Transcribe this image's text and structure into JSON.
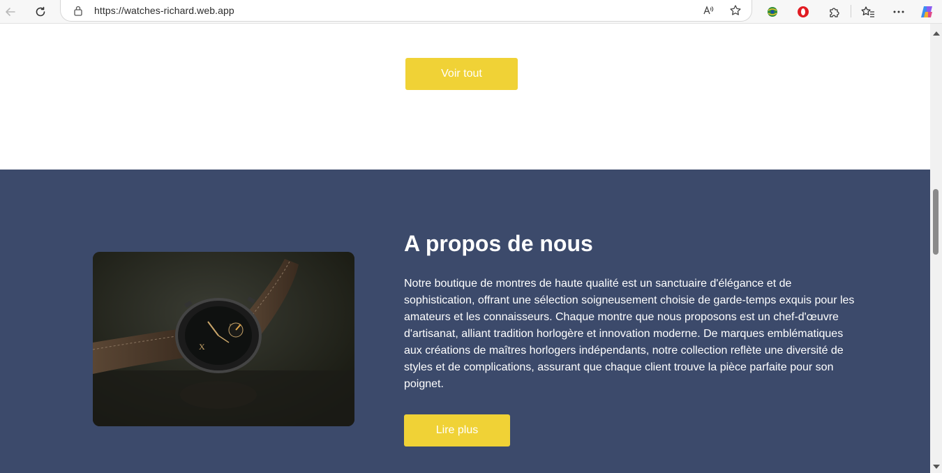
{
  "browser": {
    "url": "https://watches-richard.web.app"
  },
  "page": {
    "view_all_label": "Voir tout",
    "about": {
      "title": "A propos de nous",
      "text": "Notre boutique de montres de haute qualité est un sanctuaire d'élégance et de sophistication, offrant une sélection soigneusement choisie de garde-temps exquis pour les amateurs et les connaisseurs. Chaque montre que nous proposons est un chef-d'œuvre d'artisanat, alliant tradition horlogère et innovation moderne. De marques emblématiques aux créations de maîtres horlogers indépendants, notre collection reflète une diversité de styles et de complications, assurant que chaque client trouve la pièce parfaite pour son poignet.",
      "read_more_label": "Lire plus"
    }
  },
  "colors": {
    "accent": "#f0d236",
    "about_background": "#3c4a6b"
  },
  "icons": [
    "back-arrow-icon",
    "refresh-icon",
    "lock-icon",
    "read-aloud-icon",
    "favorite-star-icon",
    "extension-globe-icon",
    "opera-icon",
    "extensions-puzzle-icon",
    "favorites-icon",
    "more-icon",
    "copilot-icon"
  ]
}
